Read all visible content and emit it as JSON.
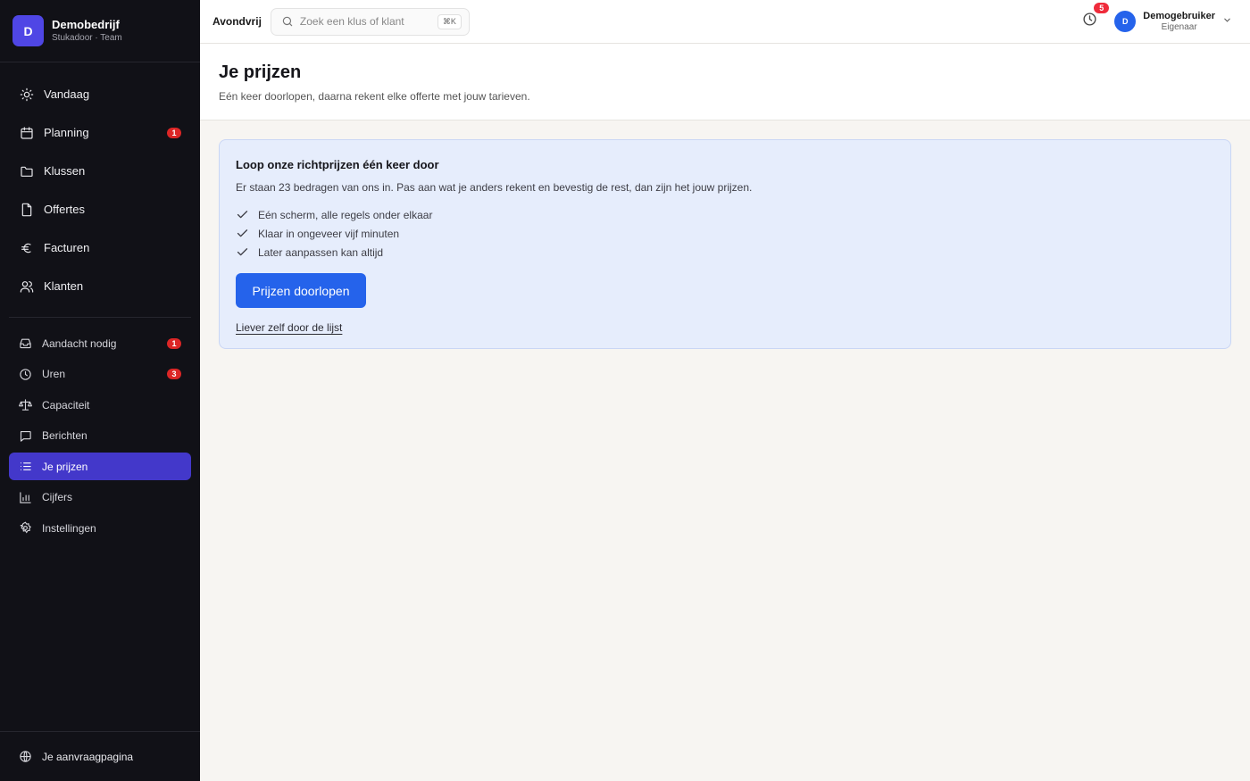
{
  "brand": {
    "initial": "D",
    "name": "Demobedrijf",
    "subtitle": "Stukadoor · Team"
  },
  "nav_primary": [
    {
      "label": "Vandaag",
      "icon": "sun-icon"
    },
    {
      "label": "Planning",
      "icon": "calendar-icon",
      "badge": "1"
    },
    {
      "label": "Klussen",
      "icon": "folder-icon"
    },
    {
      "label": "Offertes",
      "icon": "document-icon"
    },
    {
      "label": "Facturen",
      "icon": "euro-icon"
    },
    {
      "label": "Klanten",
      "icon": "users-icon"
    }
  ],
  "nav_secondary": [
    {
      "label": "Aandacht nodig",
      "icon": "inbox-icon",
      "badge": "1"
    },
    {
      "label": "Uren",
      "icon": "clock-icon",
      "badge": "3"
    },
    {
      "label": "Capaciteit",
      "icon": "scale-icon"
    },
    {
      "label": "Berichten",
      "icon": "message-icon"
    },
    {
      "label": "Je prijzen",
      "icon": "list-icon",
      "active": true
    },
    {
      "label": "Cijfers",
      "icon": "bar-chart-icon"
    },
    {
      "label": "Instellingen",
      "icon": "gear-icon"
    }
  ],
  "sidebar_footer": {
    "label": "Je aanvraagpagina",
    "icon": "globe-icon"
  },
  "topbar": {
    "company": "Avondvrij",
    "search_placeholder": "Zoek een klus of klant",
    "search_shortcut": "⌘K",
    "notifications_count": "5",
    "user": {
      "initial": "D",
      "name": "Demogebruiker",
      "role": "Eigenaar"
    }
  },
  "page": {
    "title": "Je prijzen",
    "subtitle": "Eén keer doorlopen, daarna rekent elke offerte met jouw tarieven."
  },
  "card": {
    "title": "Loop onze richtprijzen één keer door",
    "description": "Er staan 23 bedragen van ons in. Pas aan wat je anders rekent en bevestig de rest, dan zijn het jouw prijzen.",
    "checks": [
      "Eén scherm, alle regels onder elkaar",
      "Klaar in ongeveer vijf minuten",
      "Later aanpassen kan altijd"
    ],
    "primary_button": "Prijzen doorlopen",
    "secondary_link": "Liever zelf door de lijst"
  },
  "colors": {
    "sidebar_bg": "#111117",
    "accent": "#4338ca",
    "primary": "#2563eb",
    "badge": "#dc2626",
    "card_bg": "#e6edfc"
  }
}
